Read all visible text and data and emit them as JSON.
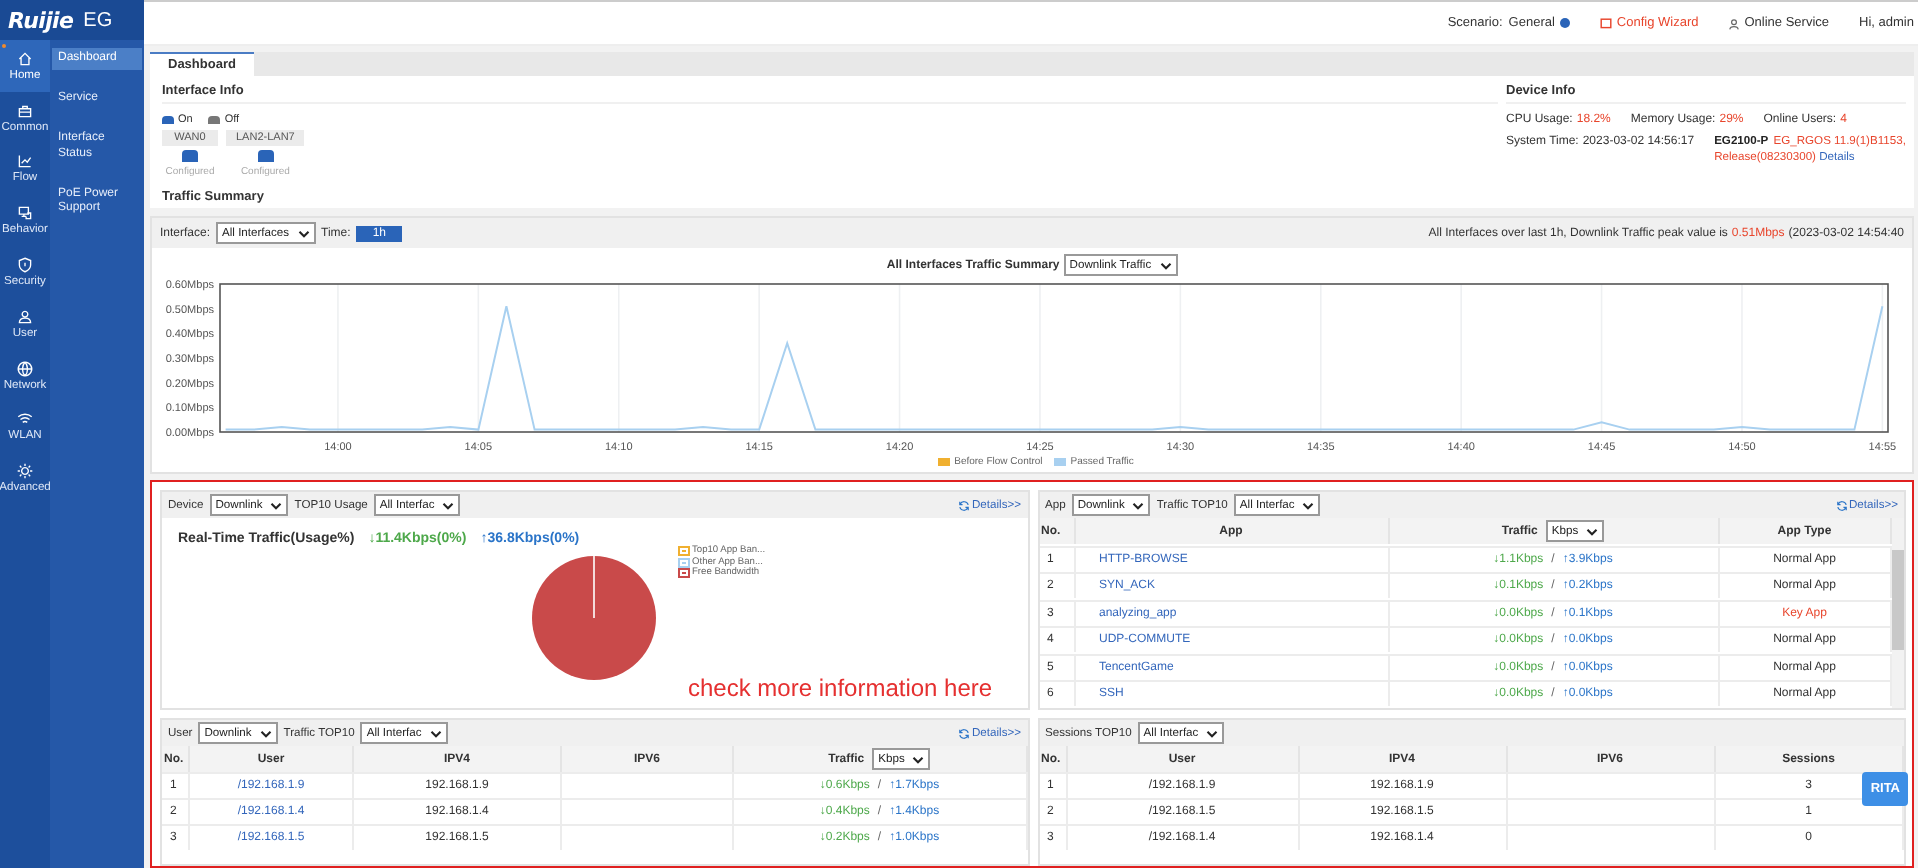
{
  "brand": {
    "logo": "Ruijie",
    "product": "EG"
  },
  "nav": [
    {
      "label": "Home",
      "selected": true
    },
    {
      "label": "Common",
      "selected": false
    },
    {
      "label": "Flow",
      "selected": false
    },
    {
      "label": "Behavior",
      "selected": false
    },
    {
      "label": "Security",
      "selected": false
    },
    {
      "label": "User",
      "selected": false
    },
    {
      "label": "Network",
      "selected": false
    },
    {
      "label": "WLAN",
      "selected": false
    },
    {
      "label": "Advanced",
      "selected": false
    }
  ],
  "subnav": [
    {
      "label": "Dashboard",
      "selected": true
    },
    {
      "label": "Service",
      "selected": false
    },
    {
      "label": "Interface Status",
      "selected": false
    },
    {
      "label": "PoE Power Support",
      "selected": false
    }
  ],
  "header": {
    "scenario_label": "Scenario:",
    "scenario": "General",
    "config_wizard": "Config Wizard",
    "online_service": "Online Service",
    "greeting": "Hi, admin"
  },
  "tabs": [
    {
      "label": "Dashboard",
      "selected": true
    }
  ],
  "interface_info": {
    "title": "Interface Info",
    "legend": [
      {
        "label": "On",
        "kind": "on"
      },
      {
        "label": "Off",
        "kind": "off"
      }
    ],
    "ports": [
      {
        "name": "WAN0",
        "status": "Configured",
        "on": true
      },
      {
        "name": "LAN2-LAN7",
        "status": "Configured",
        "on": true
      }
    ]
  },
  "device_info": {
    "title": "Device Info",
    "cpu_label": "CPU Usage:",
    "cpu": "18.2%",
    "memory_label": "Memory Usage:",
    "memory": "29%",
    "users_label": "Online Users:",
    "users": "4",
    "time_label": "System Time:",
    "time": "2023-03-02 14:56:17",
    "model": "EG2100-P",
    "version": "EG_RGOS 11.9(1)B1153,",
    "release": "Release(08230300)",
    "details": "Details"
  },
  "traffic_summary": {
    "title": "Traffic Summary",
    "interface_label": "Interface:",
    "interface": "All Interfaces",
    "time_label": "Time:",
    "time": "1h",
    "peak_text": "All Interfaces over last 1h, Downlink Traffic peak value is",
    "peak_value": "0.51Mbps",
    "peak_time": "(2023-03-02 14:54:40",
    "chart_title": "All Interfaces Traffic Summary",
    "chart_mode": "Downlink Traffic",
    "chart_data": {
      "type": "line",
      "grid": true,
      "categories": [
        null,
        null,
        null,
        null,
        "14:00",
        null,
        null,
        null,
        null,
        "14:05",
        null,
        null,
        null,
        null,
        "14:10",
        null,
        null,
        null,
        null,
        "14:15",
        null,
        null,
        null,
        null,
        "14:20",
        null,
        null,
        null,
        null,
        "14:25",
        null,
        null,
        null,
        null,
        "14:30",
        null,
        null,
        null,
        null,
        "14:35",
        null,
        null,
        null,
        null,
        "14:40",
        null,
        null,
        null,
        null,
        "14:45",
        null,
        null,
        null,
        null,
        "14:50",
        null,
        null,
        null,
        null,
        "14:55"
      ],
      "series": [
        {
          "name": "Before Flow Control",
          "color": "#f0b030",
          "values": [
            null,
            null,
            null,
            null,
            null,
            null,
            null,
            null,
            null,
            null,
            null,
            null,
            null,
            null,
            null,
            null,
            null,
            null,
            null,
            null,
            null,
            null,
            null,
            null,
            null,
            null,
            null,
            null,
            null,
            null,
            null,
            null,
            null,
            null,
            null,
            null,
            null,
            null,
            null,
            null,
            null,
            null,
            null,
            null,
            null,
            null,
            null,
            null,
            null,
            null,
            null,
            null,
            null,
            null,
            null,
            null,
            null,
            null,
            null,
            null
          ]
        },
        {
          "name": "Passed Traffic",
          "color": "#a8d0f0",
          "values": [
            0.01,
            0.01,
            0.02,
            0.01,
            0.01,
            0.01,
            0.01,
            0.01,
            0.02,
            0.01,
            0.51,
            0.01,
            0.01,
            0.01,
            0.01,
            0.01,
            0.01,
            0.02,
            0.01,
            0.01,
            0.36,
            0.01,
            0.01,
            0.01,
            0.01,
            0.01,
            0.01,
            0.01,
            0.01,
            0.01,
            0.01,
            0.01,
            0.01,
            0.01,
            0.02,
            0.01,
            0.01,
            0.01,
            0.01,
            0.01,
            0.01,
            0.01,
            0.01,
            0.01,
            0.01,
            0.01,
            0.01,
            0.01,
            0.01,
            0.04,
            0.01,
            0.01,
            0.01,
            0.01,
            0.02,
            0.01,
            0.01,
            0.01,
            0.01,
            0.51
          ]
        }
      ],
      "ylim": [
        0,
        0.6
      ],
      "yticks": [
        {
          "value": 0,
          "label": "0.00Mbps"
        },
        {
          "value": 0.1,
          "label": "0.10Mbps"
        },
        {
          "value": 0.2,
          "label": "0.20Mbps"
        },
        {
          "value": 0.3,
          "label": "0.30Mbps"
        },
        {
          "value": 0.4,
          "label": "0.40Mbps"
        },
        {
          "value": 0.5,
          "label": "0.50Mbps"
        },
        {
          "value": 0.6,
          "label": "0.60Mbps"
        }
      ]
    }
  },
  "device_panel": {
    "label": "Device",
    "direction": "Downlink",
    "scope_label": "TOP10 Usage",
    "scope": "All Interfac",
    "details": "Details>>",
    "realtime_title": "Real-Time Traffic(Usage%)",
    "down": "↓11.4Kbps(0%)",
    "up": "↑36.8Kbps(0%)",
    "legend": [
      {
        "label": "Top10 App Ban...",
        "color": "#f0b030"
      },
      {
        "label": "Other App Ban...",
        "color": "#a8d0f0"
      },
      {
        "label": "Free Bandwidth",
        "color": "#c94a4a"
      }
    ]
  },
  "app_panel": {
    "label": "App",
    "direction": "Downlink",
    "scope_label": "Traffic TOP10",
    "scope": "All Interfac",
    "details": "Details>>",
    "columns": [
      "No.",
      "App",
      "Traffic",
      "App Type"
    ],
    "unit": "Kbps",
    "separator": "/",
    "rows": [
      {
        "no": "1",
        "app": "HTTP-BROWSE",
        "down": "↓1.1Kbps",
        "up": "↑3.9Kbps",
        "type": "Normal App",
        "key": false
      },
      {
        "no": "2",
        "app": "SYN_ACK",
        "down": "↓0.1Kbps",
        "up": "↑0.2Kbps",
        "type": "Normal App",
        "key": false
      },
      {
        "no": "3",
        "app": "analyzing_app",
        "down": "↓0.0Kbps",
        "up": "↑0.1Kbps",
        "type": "Key App",
        "key": true
      },
      {
        "no": "4",
        "app": "UDP-COMMUTE",
        "down": "↓0.0Kbps",
        "up": "↑0.0Kbps",
        "type": "Normal App",
        "key": false
      },
      {
        "no": "5",
        "app": "TencentGame",
        "down": "↓0.0Kbps",
        "up": "↑0.0Kbps",
        "type": "Normal App",
        "key": false
      },
      {
        "no": "6",
        "app": "SSH",
        "down": "↓0.0Kbps",
        "up": "↑0.0Kbps",
        "type": "Normal App",
        "key": false
      }
    ]
  },
  "user_panel": {
    "label": "User",
    "direction": "Downlink",
    "scope_label": "Traffic TOP10",
    "scope": "All Interfac",
    "details": "Details>>",
    "columns": [
      "No.",
      "User",
      "IPV4",
      "IPV6",
      "Traffic"
    ],
    "unit": "Kbps",
    "separator": "/",
    "rows": [
      {
        "no": "1",
        "user": "/192.168.1.9",
        "ipv4": "192.168.1.9",
        "down": "↓0.6Kbps",
        "up": "↑1.7Kbps"
      },
      {
        "no": "2",
        "user": "/192.168.1.4",
        "ipv4": "192.168.1.4",
        "down": "↓0.4Kbps",
        "up": "↑1.4Kbps"
      },
      {
        "no": "3",
        "user": "/192.168.1.5",
        "ipv4": "192.168.1.5",
        "down": "↓0.2Kbps",
        "up": "↑1.0Kbps"
      }
    ]
  },
  "sessions_panel": {
    "scope_label": "Sessions TOP10",
    "scope": "All Interfac",
    "columns": [
      "No.",
      "User",
      "IPV4",
      "IPV6",
      "Sessions"
    ],
    "rows": [
      {
        "no": "1",
        "user": "/192.168.1.9",
        "ipv4": "192.168.1.9",
        "sessions": "3"
      },
      {
        "no": "2",
        "user": "/192.168.1.5",
        "ipv4": "192.168.1.5",
        "sessions": "1"
      },
      {
        "no": "3",
        "user": "/192.168.1.4",
        "ipv4": "192.168.1.4",
        "sessions": "0"
      }
    ]
  },
  "annotation": "check more information here",
  "assistant": "RITA"
}
